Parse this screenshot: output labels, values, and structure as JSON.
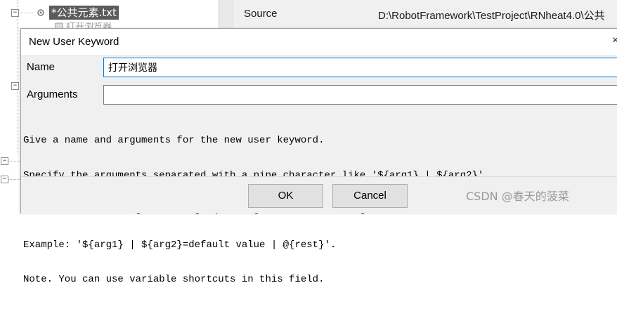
{
  "tree": {
    "selected_file": "*公共元素.txt",
    "partial_item": "打开浏览器"
  },
  "details": {
    "source_label": "Source",
    "source_value": "D:\\RobotFramework\\TestProject\\RNheat4.0\\公共"
  },
  "dialog": {
    "title": "New User Keyword",
    "close_symbol": "×",
    "name_label": "Name",
    "name_value": "打开浏览器",
    "arguments_label": "Arguments",
    "arguments_value": "",
    "help_lines": [
      "Give a name and arguments for the new user keyword.",
      "Specify the arguments separated with a pipe character like '${arg1} | ${arg2}'.",
      "Default values are given using equal sign and the last argument can be a list variable.",
      "Example: '${arg1} | ${arg2}=default value | @{rest}'.",
      "Note. You can use variable shortcuts in this field."
    ],
    "ok_label": "OK",
    "cancel_label": "Cancel"
  },
  "watermark": "CSDN @春天的菠菜"
}
